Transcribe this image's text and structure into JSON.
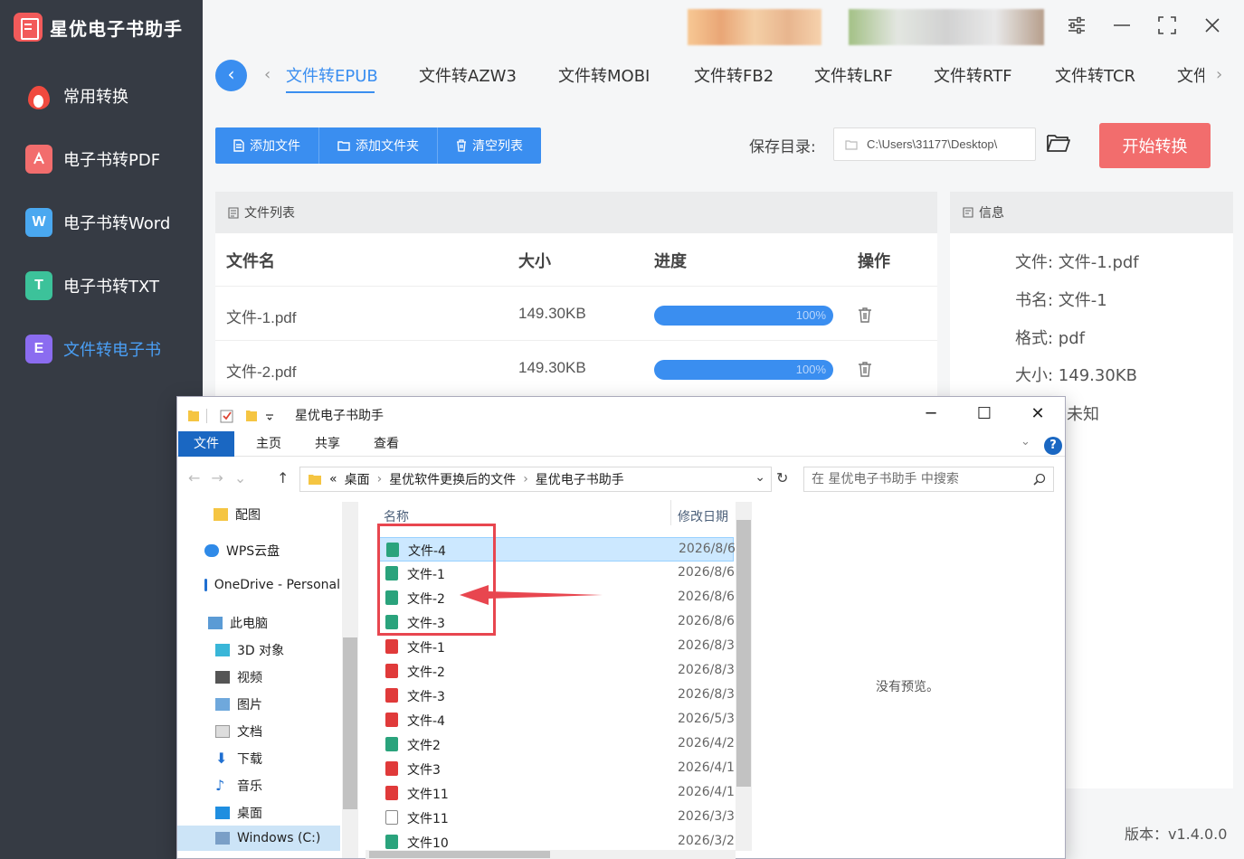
{
  "app": {
    "title": "星优电子书助手",
    "version": "版本：v1.4.0.0"
  },
  "sidebar": {
    "items": [
      {
        "label": "常用转换",
        "icon": "flame-icon",
        "color": "#f04a3f"
      },
      {
        "label": "电子书转PDF",
        "icon": "pdf-icon",
        "color": "#f26d6d"
      },
      {
        "label": "电子书转Word",
        "icon": "word-icon",
        "color": "#4aa8f0",
        "glyph": "W"
      },
      {
        "label": "电子书转TXT",
        "icon": "txt-icon",
        "color": "#3cc29a",
        "glyph": "T"
      },
      {
        "label": "文件转电子书",
        "icon": "ebook-icon",
        "color": "#8b6cf0",
        "glyph": "E"
      }
    ]
  },
  "tabs": [
    "文件转EPUB",
    "文件转AZW3",
    "文件转MOBI",
    "文件转FB2",
    "文件转LRF",
    "文件转RTF",
    "文件转TCR",
    "文件"
  ],
  "toolbar": {
    "add_file": "添加文件",
    "add_folder": "添加文件夹",
    "clear_list": "清空列表"
  },
  "save": {
    "label": "保存目录:",
    "path": "C:\\Users\\31177\\Desktop\\"
  },
  "start_button": "开始转换",
  "file_list": {
    "title": "文件列表",
    "columns": [
      "文件名",
      "大小",
      "进度",
      "操作"
    ],
    "rows": [
      {
        "name": "文件-1.pdf",
        "size": "149.30KB",
        "progress": "100%"
      },
      {
        "name": "文件-2.pdf",
        "size": "149.30KB",
        "progress": "100%"
      }
    ]
  },
  "info": {
    "title": "信息",
    "file": "文件:  文件-1.pdf",
    "book": "书名:  文件-1",
    "format": "格式:  pdf",
    "size": "大小:  149.30KB",
    "author": "未知"
  },
  "explorer": {
    "title": "星优电子书助手",
    "ribbon": [
      "文件",
      "主页",
      "共享",
      "查看"
    ],
    "help": "?",
    "breadcrumb": [
      "«",
      "桌面",
      "星优软件更换后的文件",
      "星优电子书助手"
    ],
    "search_placeholder": "在 星优电子书助手 中搜索",
    "tree": [
      "配图",
      "WPS云盘",
      "OneDrive - Personal",
      "此电脑",
      "3D 对象",
      "视频",
      "图片",
      "文档",
      "下载",
      "音乐",
      "桌面",
      "Windows (C:)"
    ],
    "columns": {
      "name": "名称",
      "date": "修改日期"
    },
    "files": [
      {
        "name": "文件-4",
        "type": "epub",
        "date": "2026/8/6"
      },
      {
        "name": "文件-1",
        "type": "epub",
        "date": "2026/8/6"
      },
      {
        "name": "文件-2",
        "type": "epub",
        "date": "2026/8/6"
      },
      {
        "name": "文件-3",
        "type": "epub",
        "date": "2026/8/6"
      },
      {
        "name": "文件-1",
        "type": "pdf",
        "date": "2026/8/3"
      },
      {
        "name": "文件-2",
        "type": "pdf",
        "date": "2026/8/3"
      },
      {
        "name": "文件-3",
        "type": "pdf",
        "date": "2026/8/3"
      },
      {
        "name": "文件-4",
        "type": "pdf",
        "date": "2026/5/3"
      },
      {
        "name": "文件2",
        "type": "epub",
        "date": "2026/4/2"
      },
      {
        "name": "文件3",
        "type": "pdf",
        "date": "2026/4/1"
      },
      {
        "name": "文件11",
        "type": "pdf",
        "date": "2026/4/1"
      },
      {
        "name": "文件11",
        "type": "txt",
        "date": "2026/3/3"
      },
      {
        "name": "文件10",
        "type": "epub",
        "date": "2026/3/2"
      }
    ],
    "preview_text": "没有预览。"
  }
}
